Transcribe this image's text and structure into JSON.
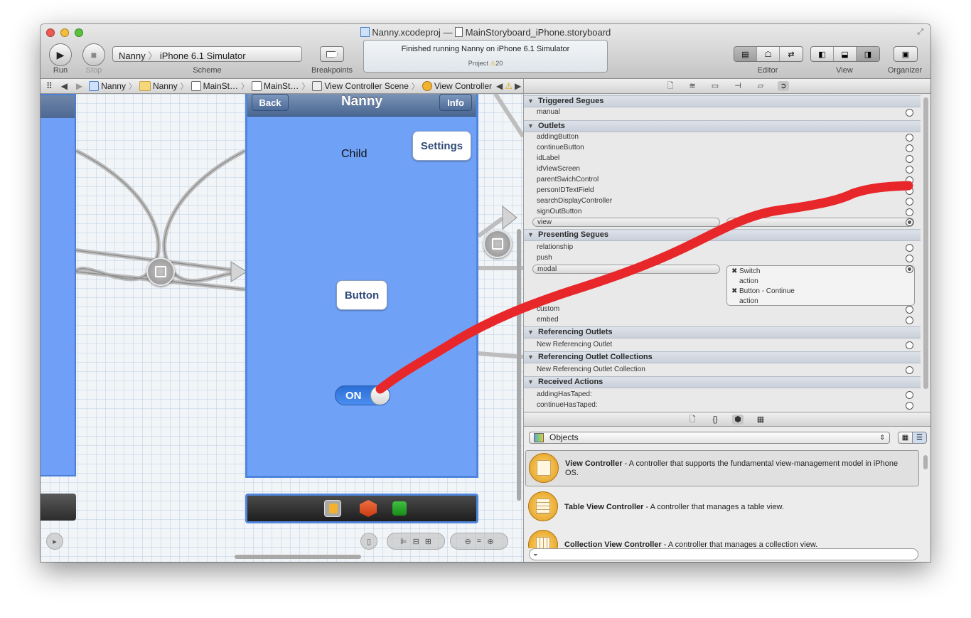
{
  "window": {
    "project_file": "Nanny.xcodeproj",
    "separator": "—",
    "storyboard_file": "MainStoryboard_iPhone.storyboard"
  },
  "toolbar": {
    "run_label": "Run",
    "stop_label": "Stop",
    "scheme_target": "Nanny",
    "scheme_device": "iPhone 6.1 Simulator",
    "scheme_label": "Scheme",
    "breakpoints_label": "Breakpoints",
    "status_text": "Finished running Nanny on iPhone 6.1 Simulator",
    "status_project": "Project",
    "warning_count": "20",
    "editor_label": "Editor",
    "view_label": "View",
    "organizer_label": "Organizer"
  },
  "jumpbar": {
    "crumbs": [
      "Nanny",
      "Nanny",
      "MainSt…",
      "MainSt…",
      "View Controller Scene",
      "View Controller"
    ]
  },
  "scene": {
    "nav_title": "Nanny",
    "back_label": "Back",
    "info_label": "Info",
    "settings_label": "Settings",
    "child_label": "Child",
    "button_label": "Button",
    "switch_label": "ON"
  },
  "inspector": {
    "triggered_segues": {
      "title": "Triggered Segues",
      "items": [
        "manual"
      ]
    },
    "outlets": {
      "title": "Outlets",
      "items": [
        "addingButton",
        "continueButton",
        "idLabel",
        "idViewScreen",
        "parentSwichControl",
        "personIDTextField",
        "searchDisplayController",
        "signOutButton",
        "view"
      ]
    },
    "presenting_segues": {
      "title": "Presenting Segues",
      "items": [
        "relationship",
        "push",
        "modal",
        "custom",
        "embed"
      ],
      "modal_connections": [
        "Switch",
        "action",
        "Button - Continue",
        "action"
      ]
    },
    "referencing_outlets": {
      "title": "Referencing Outlets",
      "items": [
        "New Referencing Outlet"
      ]
    },
    "referencing_outlet_collections": {
      "title": "Referencing Outlet Collections",
      "items": [
        "New Referencing Outlet Collection"
      ]
    },
    "received_actions": {
      "title": "Received Actions",
      "items": [
        "addingHasTaped:",
        "continueHasTaped:"
      ]
    }
  },
  "library": {
    "category": "Objects",
    "items": [
      {
        "name": "View Controller",
        "desc": " - A controller that supports the fundamental view-management model in iPhone OS."
      },
      {
        "name": "Table View Controller",
        "desc": " - A controller that manages a table view."
      },
      {
        "name": "Collection View Controller",
        "desc": " - A controller that manages a collection view."
      }
    ]
  },
  "colors": {
    "scene_blue": "#6fa1f6",
    "connection_red": "#e8272a",
    "switch_blue": "#2a6fd6"
  }
}
